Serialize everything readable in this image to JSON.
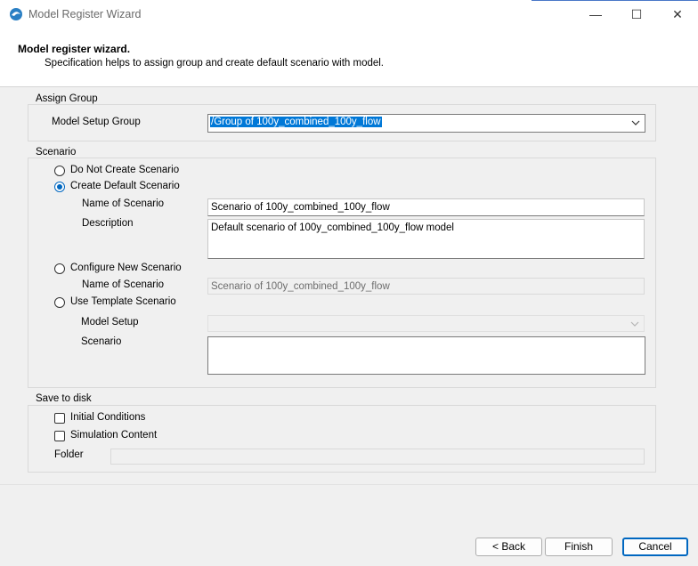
{
  "window": {
    "title": "Model Register Wizard",
    "minimize_glyph": "—",
    "maximize_glyph": "☐",
    "close_glyph": "✕"
  },
  "header": {
    "title": "Model register wizard.",
    "subtitle": "Specification helps to assign group and create default scenario with model."
  },
  "assign_group": {
    "legend": "Assign Group",
    "label": "Model Setup Group",
    "value": "/Group of 100y_combined_100y_flow"
  },
  "scenario": {
    "legend": "Scenario",
    "options": {
      "do_not_create": "Do Not Create Scenario",
      "create_default": "Create Default Scenario",
      "configure_new": "Configure New Scenario",
      "use_template": "Use Template Scenario"
    },
    "selected": "create_default",
    "default_name_label": "Name of Scenario",
    "default_name_value": "Scenario of 100y_combined_100y_flow",
    "description_label": "Description",
    "description_value": "Default scenario of 100y_combined_100y_flow model",
    "new_name_label": "Name of Scenario",
    "new_name_value": "Scenario of 100y_combined_100y_flow",
    "model_setup_label": "Model Setup",
    "template_scenario_label": "Scenario"
  },
  "save_to_disk": {
    "legend": "Save to disk",
    "initial_conditions": "Initial Conditions",
    "simulation_content": "Simulation Content",
    "folder_label": "Folder",
    "folder_value": ""
  },
  "footer": {
    "back": "< Back",
    "finish": "Finish",
    "cancel": "Cancel"
  },
  "colors": {
    "accent": "#0067c0",
    "selection": "#0078d7"
  }
}
